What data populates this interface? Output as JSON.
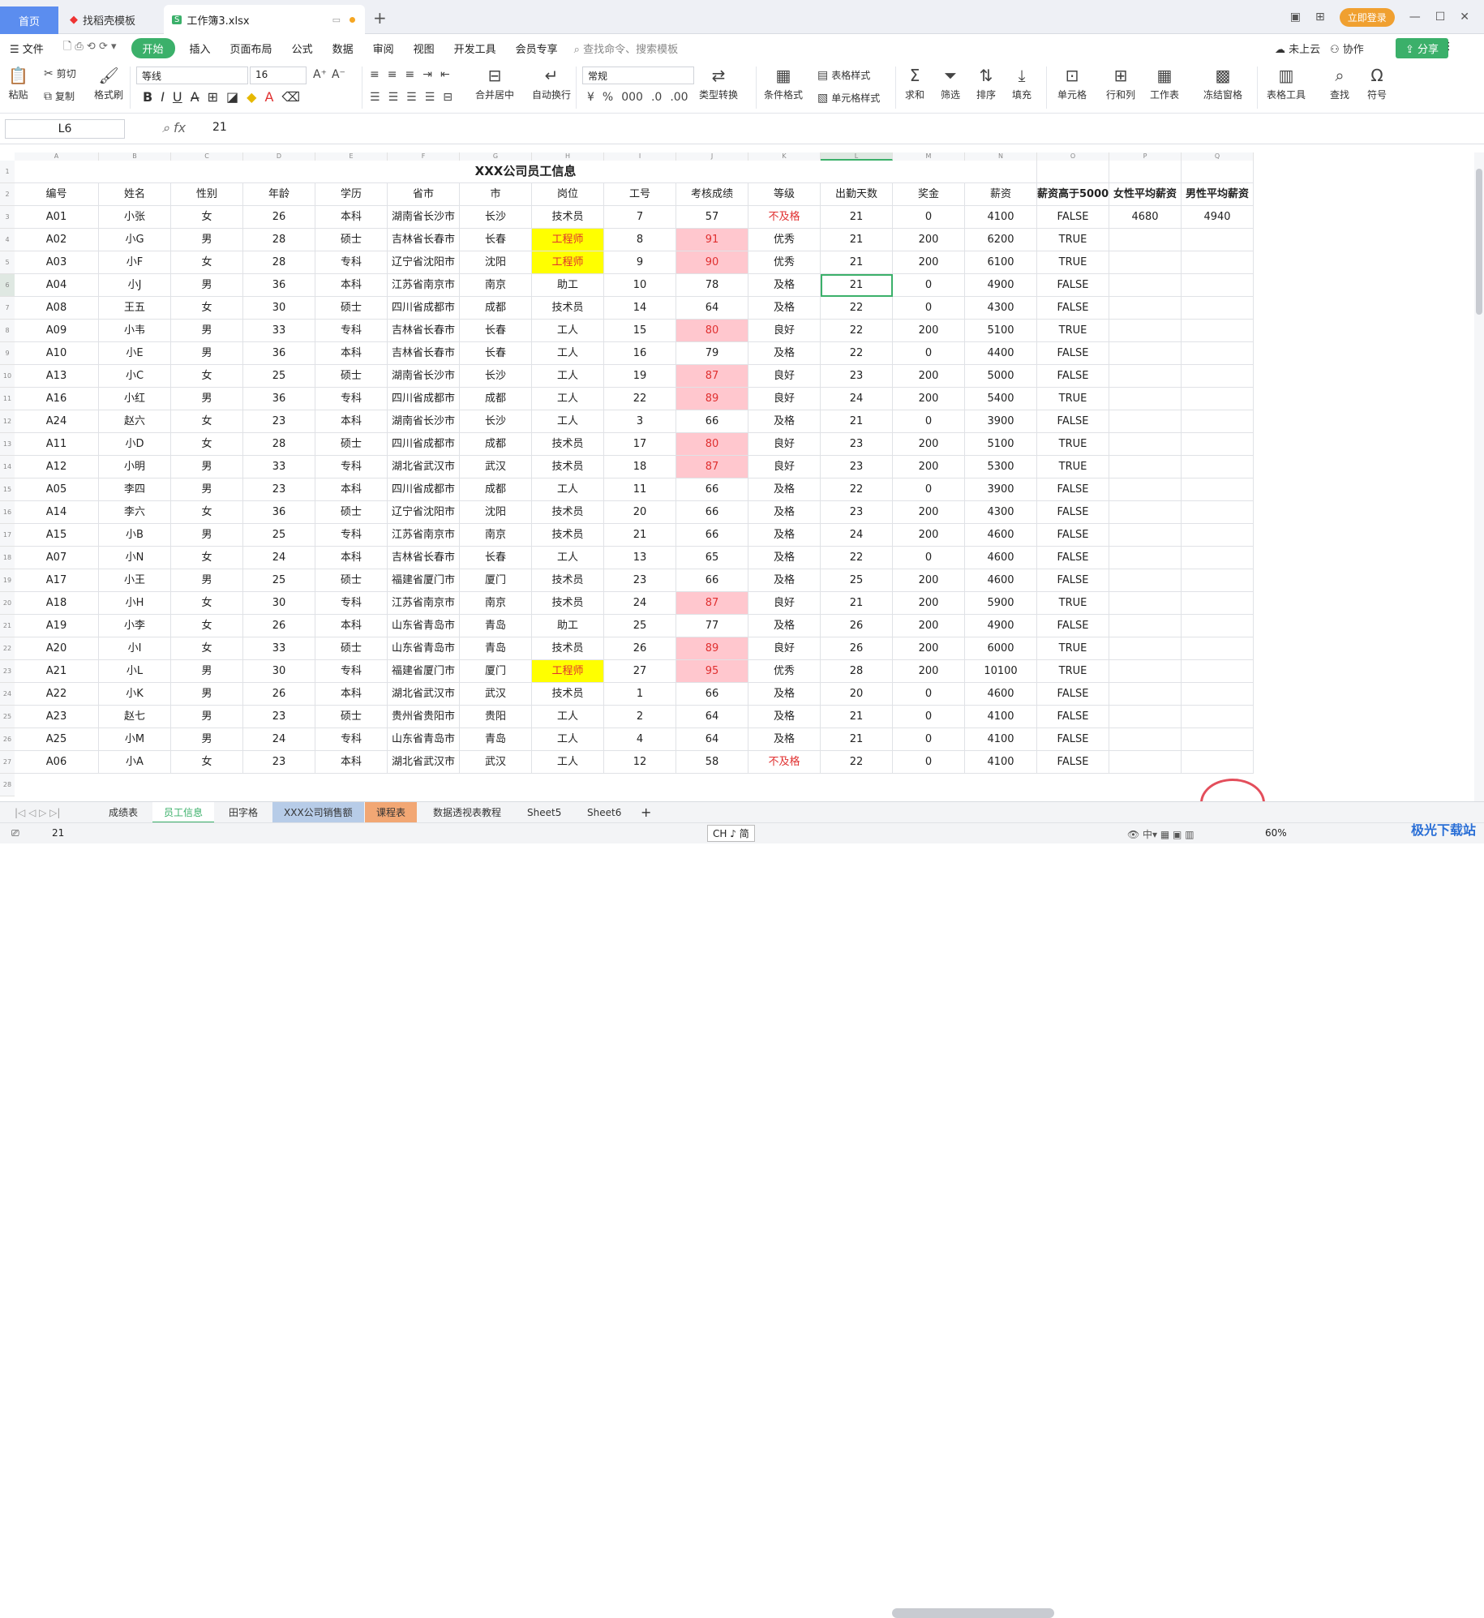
{
  "titlebar": {
    "tab_home": "首页",
    "tab_template": "找稻壳模板",
    "tab_doc": "工作簿3.xlsx",
    "login": "立即登录"
  },
  "menu": {
    "file": "文件",
    "items": [
      "开始",
      "插入",
      "页面布局",
      "公式",
      "数据",
      "审阅",
      "视图",
      "开发工具",
      "会员专享"
    ],
    "search": "查找命令、搜索模板",
    "cloud": "未上云",
    "collab": "协作",
    "share": "分享"
  },
  "toolbar": {
    "paste": "粘贴",
    "cut": "剪切",
    "copy": "复制",
    "format_painter": "格式刷",
    "font": "等线",
    "size": "16",
    "number_format": "常规",
    "merge": "合并居中",
    "wrap": "自动换行",
    "type_convert": "类型转换",
    "conditional": "条件格式",
    "table_style": "表格样式",
    "cell_style": "单元格样式",
    "sum": "求和",
    "filter": "筛选",
    "sort": "排序",
    "fill": "填充",
    "cell": "单元格",
    "rowcol": "行和列",
    "sheet": "工作表",
    "freeze": "冻结窗格",
    "table_tools": "表格工具",
    "find": "查找",
    "symbol": "符号"
  },
  "formula": {
    "cell_ref": "L6",
    "fx": "fx",
    "value": "21"
  },
  "sheet": {
    "title": "XXX公司员工信息",
    "col_letters": [
      "A",
      "B",
      "C",
      "D",
      "E",
      "F",
      "G",
      "H",
      "I",
      "J",
      "K",
      "L",
      "M",
      "N",
      "O",
      "P",
      "Q"
    ],
    "headers": [
      "编号",
      "姓名",
      "性别",
      "年龄",
      "学历",
      "省市",
      "市",
      "岗位",
      "工号",
      "考核成绩",
      "等级",
      "出勤天数",
      "奖金",
      "薪资",
      "薪资高于5000",
      "女性平均薪资",
      "男性平均薪资"
    ],
    "summary": {
      "female_avg": "4680",
      "male_avg": "4940"
    },
    "rows": [
      [
        "A01",
        "小张",
        "女",
        "26",
        "本科",
        "湖南省长沙市",
        "长沙",
        "技术员",
        "7",
        "57",
        "不及格",
        "21",
        "0",
        "4100",
        "FALSE"
      ],
      [
        "A02",
        "小G",
        "男",
        "28",
        "硕士",
        "吉林省长春市",
        "长春",
        "工程师",
        "8",
        "91",
        "优秀",
        "21",
        "200",
        "6200",
        "TRUE"
      ],
      [
        "A03",
        "小F",
        "女",
        "28",
        "专科",
        "辽宁省沈阳市",
        "沈阳",
        "工程师",
        "9",
        "90",
        "优秀",
        "21",
        "200",
        "6100",
        "TRUE"
      ],
      [
        "A04",
        "小J",
        "男",
        "36",
        "本科",
        "江苏省南京市",
        "南京",
        "助工",
        "10",
        "78",
        "及格",
        "21",
        "0",
        "4900",
        "FALSE"
      ],
      [
        "A08",
        "王五",
        "女",
        "30",
        "硕士",
        "四川省成都市",
        "成都",
        "技术员",
        "14",
        "64",
        "及格",
        "22",
        "0",
        "4300",
        "FALSE"
      ],
      [
        "A09",
        "小韦",
        "男",
        "33",
        "专科",
        "吉林省长春市",
        "长春",
        "工人",
        "15",
        "80",
        "良好",
        "22",
        "200",
        "5100",
        "TRUE"
      ],
      [
        "A10",
        "小E",
        "男",
        "36",
        "本科",
        "吉林省长春市",
        "长春",
        "工人",
        "16",
        "79",
        "及格",
        "22",
        "0",
        "4400",
        "FALSE"
      ],
      [
        "A13",
        "小C",
        "女",
        "25",
        "硕士",
        "湖南省长沙市",
        "长沙",
        "工人",
        "19",
        "87",
        "良好",
        "23",
        "200",
        "5000",
        "FALSE"
      ],
      [
        "A16",
        "小红",
        "男",
        "36",
        "专科",
        "四川省成都市",
        "成都",
        "工人",
        "22",
        "89",
        "良好",
        "24",
        "200",
        "5400",
        "TRUE"
      ],
      [
        "A24",
        "赵六",
        "女",
        "23",
        "本科",
        "湖南省长沙市",
        "长沙",
        "工人",
        "3",
        "66",
        "及格",
        "21",
        "0",
        "3900",
        "FALSE"
      ],
      [
        "A11",
        "小D",
        "女",
        "28",
        "硕士",
        "四川省成都市",
        "成都",
        "技术员",
        "17",
        "80",
        "良好",
        "23",
        "200",
        "5100",
        "TRUE"
      ],
      [
        "A12",
        "小明",
        "男",
        "33",
        "专科",
        "湖北省武汉市",
        "武汉",
        "技术员",
        "18",
        "87",
        "良好",
        "23",
        "200",
        "5300",
        "TRUE"
      ],
      [
        "A05",
        "李四",
        "男",
        "23",
        "本科",
        "四川省成都市",
        "成都",
        "工人",
        "11",
        "66",
        "及格",
        "22",
        "0",
        "3900",
        "FALSE"
      ],
      [
        "A14",
        "李六",
        "女",
        "36",
        "硕士",
        "辽宁省沈阳市",
        "沈阳",
        "技术员",
        "20",
        "66",
        "及格",
        "23",
        "200",
        "4300",
        "FALSE"
      ],
      [
        "A15",
        "小B",
        "男",
        "25",
        "专科",
        "江苏省南京市",
        "南京",
        "技术员",
        "21",
        "66",
        "及格",
        "24",
        "200",
        "4600",
        "FALSE"
      ],
      [
        "A07",
        "小N",
        "女",
        "24",
        "本科",
        "吉林省长春市",
        "长春",
        "工人",
        "13",
        "65",
        "及格",
        "22",
        "0",
        "4600",
        "FALSE"
      ],
      [
        "A17",
        "小王",
        "男",
        "25",
        "硕士",
        "福建省厦门市",
        "厦门",
        "技术员",
        "23",
        "66",
        "及格",
        "25",
        "200",
        "4600",
        "FALSE"
      ],
      [
        "A18",
        "小H",
        "女",
        "30",
        "专科",
        "江苏省南京市",
        "南京",
        "技术员",
        "24",
        "87",
        "良好",
        "21",
        "200",
        "5900",
        "TRUE"
      ],
      [
        "A19",
        "小李",
        "女",
        "26",
        "本科",
        "山东省青岛市",
        "青岛",
        "助工",
        "25",
        "77",
        "及格",
        "26",
        "200",
        "4900",
        "FALSE"
      ],
      [
        "A20",
        "小I",
        "女",
        "33",
        "硕士",
        "山东省青岛市",
        "青岛",
        "技术员",
        "26",
        "89",
        "良好",
        "26",
        "200",
        "6000",
        "TRUE"
      ],
      [
        "A21",
        "小L",
        "男",
        "30",
        "专科",
        "福建省厦门市",
        "厦门",
        "工程师",
        "27",
        "95",
        "优秀",
        "28",
        "200",
        "10100",
        "TRUE"
      ],
      [
        "A22",
        "小K",
        "男",
        "26",
        "本科",
        "湖北省武汉市",
        "武汉",
        "技术员",
        "1",
        "66",
        "及格",
        "20",
        "0",
        "4600",
        "FALSE"
      ],
      [
        "A23",
        "赵七",
        "男",
        "23",
        "硕士",
        "贵州省贵阳市",
        "贵阳",
        "工人",
        "2",
        "64",
        "及格",
        "21",
        "0",
        "4100",
        "FALSE"
      ],
      [
        "A25",
        "小M",
        "男",
        "24",
        "专科",
        "山东省青岛市",
        "青岛",
        "工人",
        "4",
        "64",
        "及格",
        "21",
        "0",
        "4100",
        "FALSE"
      ],
      [
        "A06",
        "小A",
        "女",
        "23",
        "本科",
        "湖北省武汉市",
        "武汉",
        "工人",
        "12",
        "58",
        "不及格",
        "22",
        "0",
        "4100",
        "FALSE"
      ]
    ]
  },
  "sheet_tabs": [
    "成绩表",
    "员工信息",
    "田字格",
    "XXX公司销售额",
    "课程表",
    "数据透视表教程",
    "Sheet5",
    "Sheet6"
  ],
  "status": {
    "value": "21",
    "ime": "CH ♪ 简",
    "zoom": "60%",
    "logo": "极光下载站"
  },
  "colors": {
    "accent": "#3bb06a",
    "highlight_yellow": "#ffff00",
    "highlight_pink": "#ffc7ce",
    "red_text": "#e03030"
  }
}
